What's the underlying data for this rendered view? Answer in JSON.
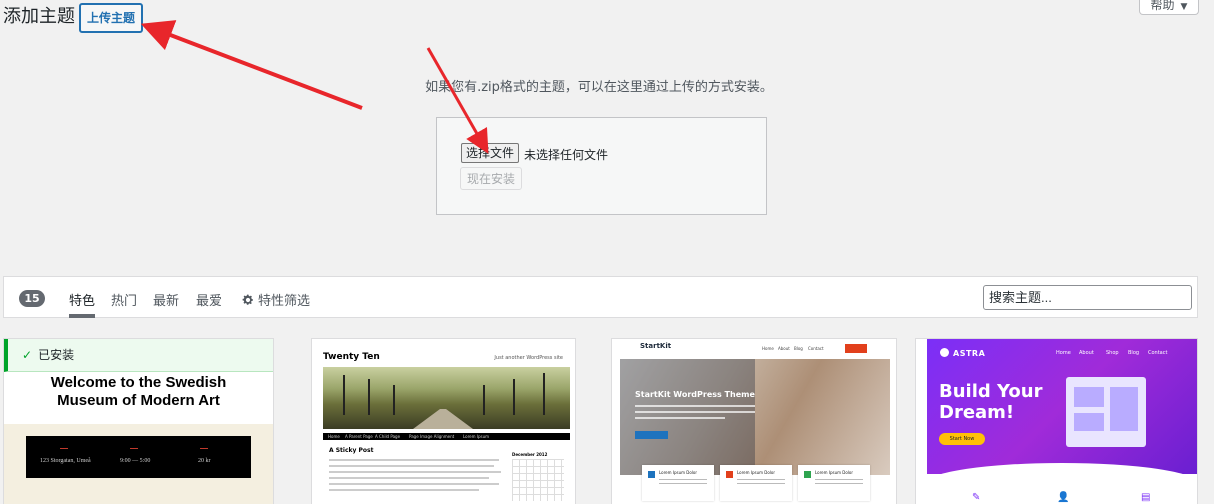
{
  "header": {
    "title": "添加主题",
    "upload_button": "上传主题",
    "help_tab": "帮助"
  },
  "upload": {
    "description": "如果您有.zip格式的主题，可以在这里通过上传的方式安装。",
    "choose_file": "选择文件",
    "no_file": "未选择任何文件",
    "install_now": "现在安装"
  },
  "filter": {
    "count": "15",
    "tabs": [
      "特色",
      "热门",
      "最新",
      "最爱"
    ],
    "feature_filter": "特性筛选",
    "search_placeholder": "搜索主题..."
  },
  "themes": [
    {
      "installed_label": "已安装",
      "shot_title_line1": "Welcome to the Swedish",
      "shot_title_line2": "Museum of Modern Art",
      "shot_info": [
        "123 Storgatan, Umeå",
        "9:00 — 5:00",
        "20 kr"
      ]
    },
    {
      "shot_name": "Twenty Ten",
      "shot_tagline": "Just another WordPress site",
      "nav": [
        "Home",
        "A Parent Page",
        "A Child Page",
        "Page Image Alignment",
        "Lorem Ipsum"
      ],
      "post_title": "A Sticky Post",
      "calendar_title": "December 2012"
    },
    {
      "shot_logo": "StartKit",
      "nav": [
        "Home",
        "About",
        "Blog",
        "Contact"
      ],
      "hero_title": "StartKit WordPress Theme",
      "feature_titles": [
        "Lorem Ipsum Dolor",
        "Lorem Ipsum Dolor",
        "Lorem Ipsum Dolor"
      ]
    },
    {
      "shot_logo": "ASTRA",
      "nav": [
        "Home",
        "About",
        "Shop",
        "Blog",
        "Contact"
      ],
      "hero_line1": "Build Your",
      "hero_line2": "Dream!",
      "cta": "Start Now"
    }
  ],
  "colors": {
    "accent": "#2271b1",
    "arrow": "#e8262b",
    "installed": "#00a32a"
  }
}
